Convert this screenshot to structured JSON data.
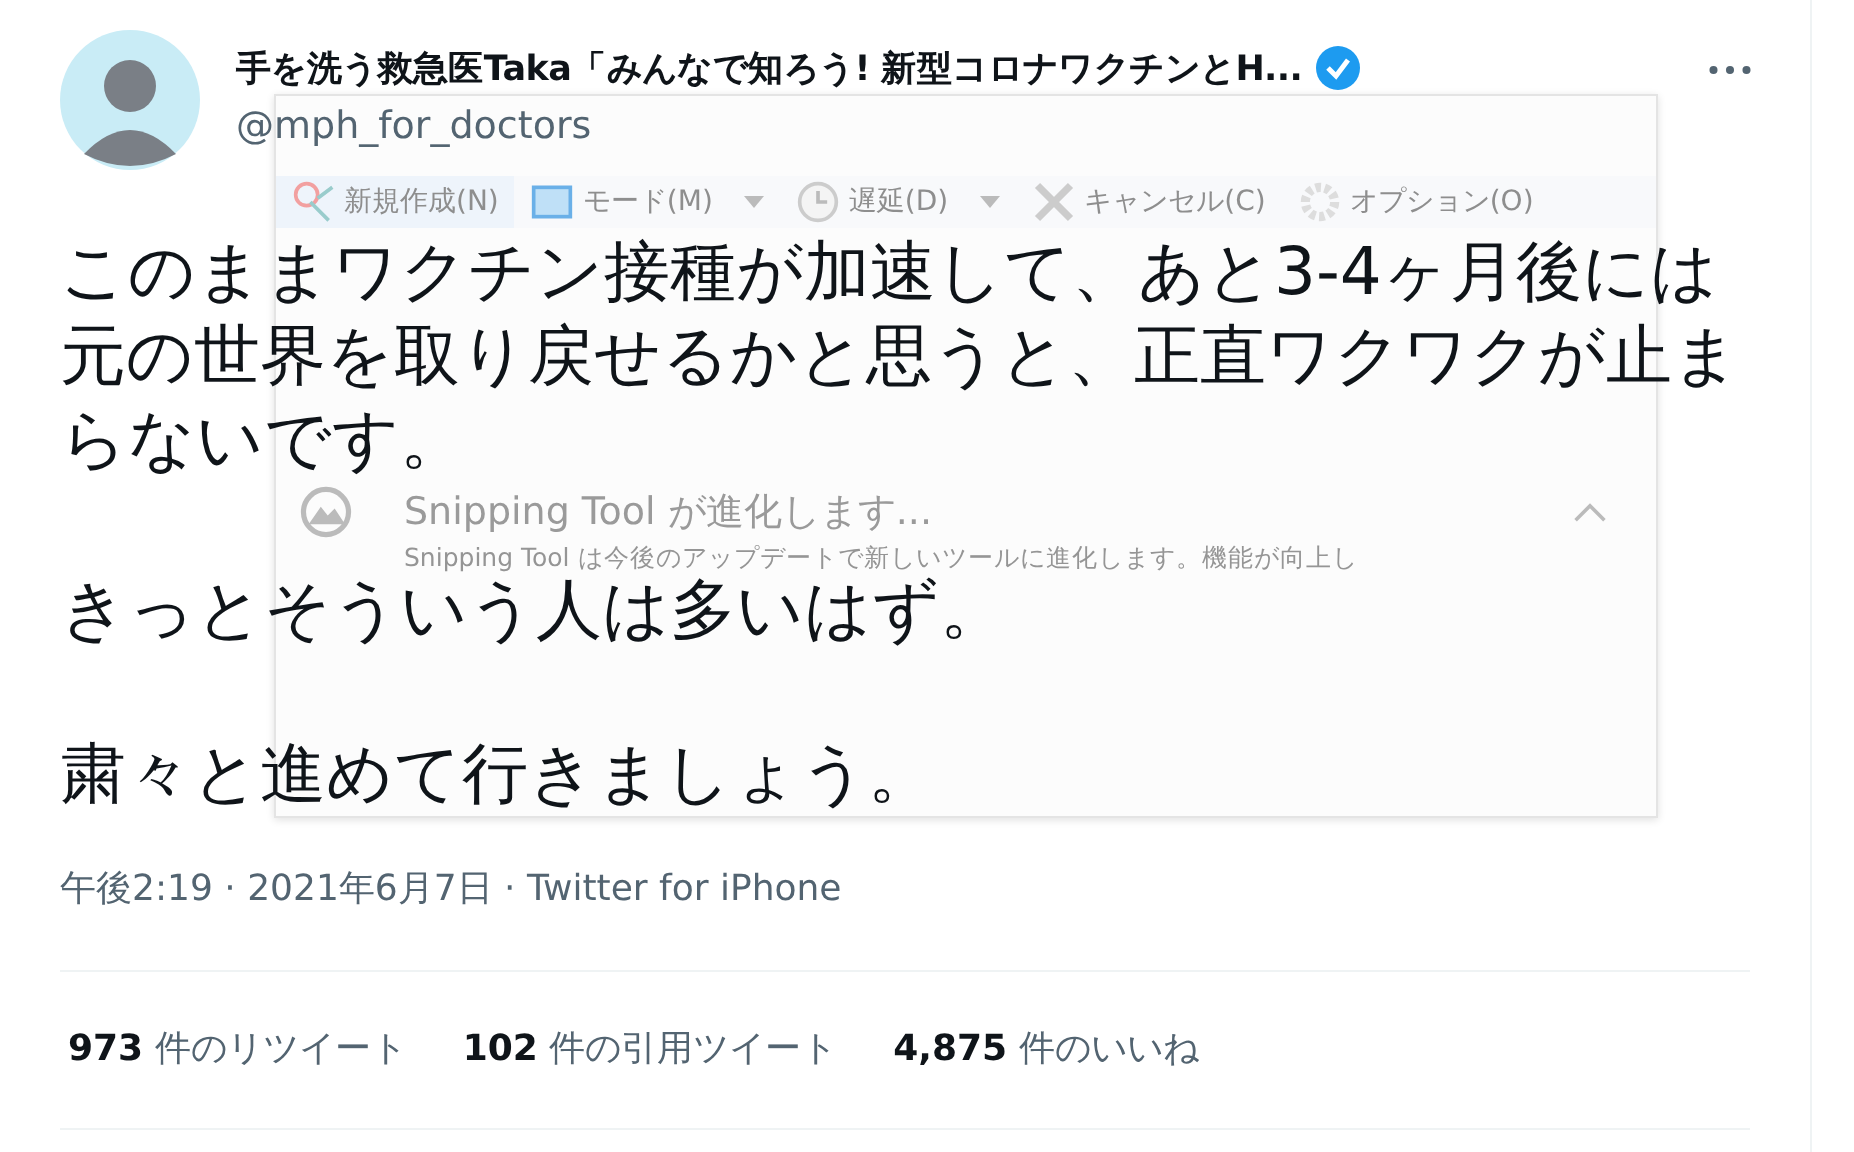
{
  "tweet": {
    "display_name": "手を洗う救急医Taka「みんなで知ろう! 新型コロナワクチンとH...",
    "verified": true,
    "handle": "@mph_for_doctors",
    "paragraphs": [
      "このままワクチン接種が加速して、あと3-4ヶ月後には元の世界を取り戻せるかと思うと、正直ワクワクが止まらないです。",
      "きっとそういう人は多いはず。",
      "粛々と進めて行きましょう。"
    ],
    "timestamp": "午後2:19 · 2021年6月7日 · Twitter for iPhone",
    "stats": [
      {
        "count": "973",
        "label": "件のリツイート"
      },
      {
        "count": "102",
        "label": "件の引用ツイート"
      },
      {
        "count": "4,875",
        "label": "件のいいね"
      }
    ]
  },
  "snipping_tool": {
    "toolbar": [
      {
        "kind": "new",
        "label": "新規作成(N)",
        "dropdown": false
      },
      {
        "kind": "mode",
        "label": "モード(M)",
        "dropdown": true
      },
      {
        "kind": "delay",
        "label": "遅延(D)",
        "dropdown": true
      },
      {
        "kind": "cancel",
        "label": "キャンセル(C)",
        "dropdown": false
      },
      {
        "kind": "options",
        "label": "オプション(O)",
        "dropdown": false
      }
    ],
    "notice_title": "Snipping Tool が進化します...",
    "notice_body": "Snipping Tool は今後のアップデートで新しいツールに進化します。機能が向上し"
  }
}
